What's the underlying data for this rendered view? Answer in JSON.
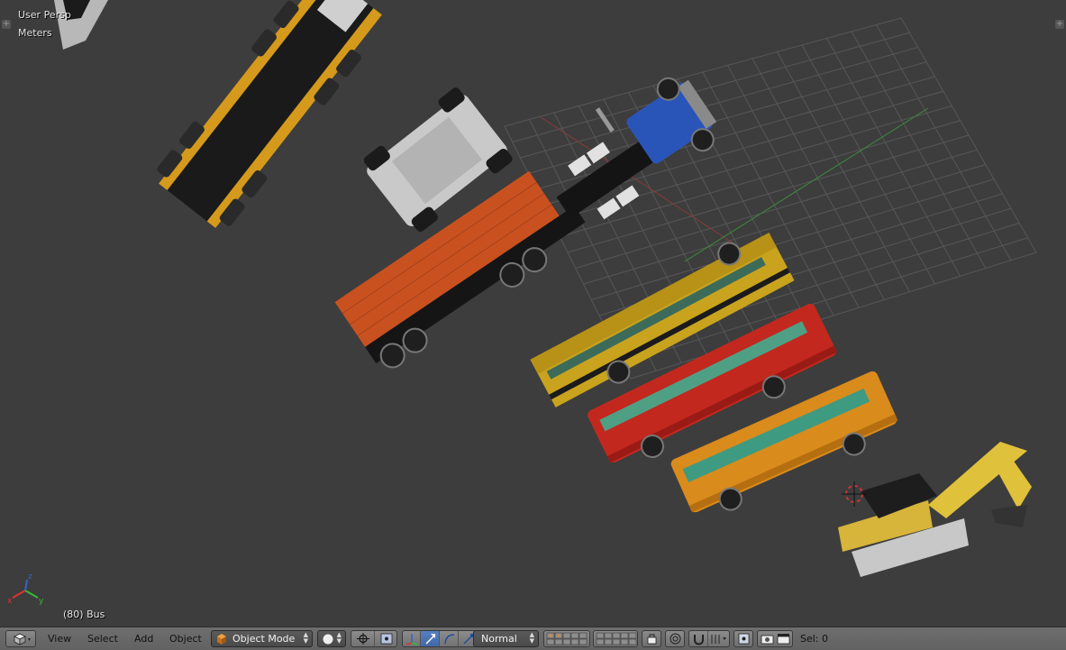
{
  "viewport": {
    "view_name": "User Persp",
    "units": "Meters",
    "active_object": "(80) Bus"
  },
  "header": {
    "menu": {
      "view": "View",
      "select": "Select",
      "add": "Add",
      "object": "Object"
    },
    "mode": "Object Mode",
    "pivot": "Normal",
    "selection_count": "Sel: 0"
  },
  "colors": {
    "background": "#3d3d3d",
    "grid": "#595959",
    "axis_x": "#8a3a3a",
    "axis_y": "#3c8a3c",
    "active_highlight": "#5680c2"
  },
  "icons": {
    "editor_type": "3d-view-cube-icon",
    "mode_icon": "object-cube-icon",
    "shading": "solid-sphere-icon",
    "pivot": "pivot-point-icon",
    "manipulator": "transform-manipulator-icon",
    "snap": "magnet-icon",
    "render": "camera-render-icon"
  }
}
